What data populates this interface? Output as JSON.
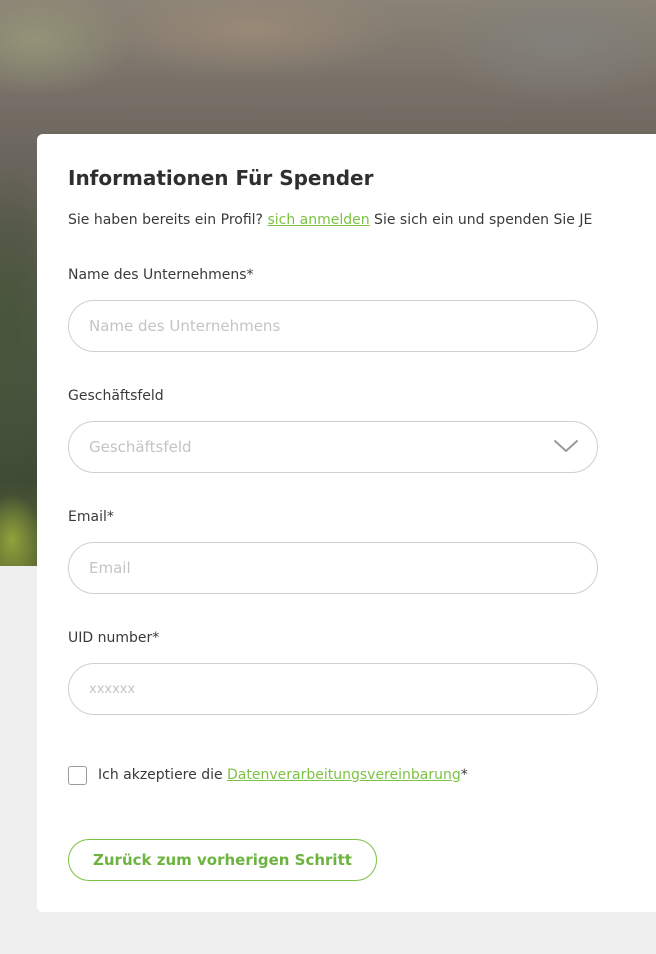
{
  "form": {
    "title": "Informationen Für Spender",
    "subtitle": {
      "before_link": "Sie haben bereits ein Profil? ",
      "link_text": "sich anmelden",
      "after_link": " Sie sich ein und spenden Sie JE"
    },
    "fields": {
      "company_name": {
        "label": "Name des Unternehmens*",
        "placeholder": "Name des Unternehmens",
        "value": ""
      },
      "business_field": {
        "label": "Geschäftsfeld",
        "placeholder": "Geschäftsfeld",
        "icon": "chevron-down-icon"
      },
      "email": {
        "label": "Email*",
        "placeholder": "Email",
        "value": ""
      },
      "uid": {
        "label": "UID number*",
        "placeholder": "xxxxxx",
        "value": ""
      }
    },
    "consent": {
      "checked": false,
      "text_before": "Ich akzeptiere die ",
      "link_text": "Datenverarbeitungsvereinbarung",
      "required_mark": "*"
    },
    "back_button_label": "Zurück zum vorherigen Schritt"
  },
  "colors": {
    "accent": "#7cc242",
    "text": "#3a3a3a",
    "border": "#cfcfcf",
    "placeholder": "#c4c4c4",
    "page_bg": "#efefef"
  }
}
